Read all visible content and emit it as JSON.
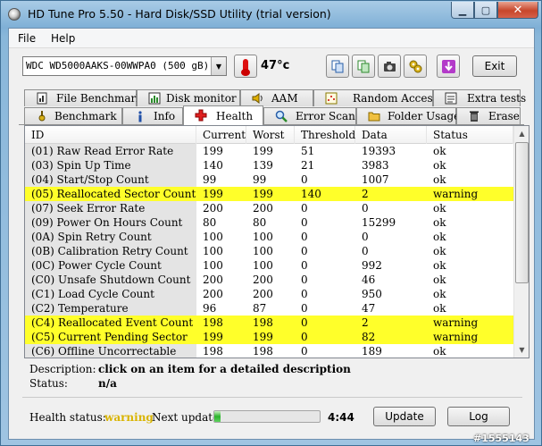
{
  "window": {
    "title": "HD Tune Pro 5.50 - Hard Disk/SSD Utility (trial version)"
  },
  "menu": {
    "file": "File",
    "help": "Help"
  },
  "toolbar": {
    "drive": "WDC WD5000AAKS-00WWPA0 (500 gB)",
    "temperature": "47°c",
    "exit": "Exit"
  },
  "tabs_top": [
    {
      "label": "File Benchmark",
      "icon": "file-benchmark-icon"
    },
    {
      "label": "Disk monitor",
      "icon": "disk-monitor-icon"
    },
    {
      "label": "AAM",
      "icon": "speaker-icon"
    },
    {
      "label": "Random Access",
      "icon": "random-access-icon"
    },
    {
      "label": "Extra tests",
      "icon": "extra-tests-icon"
    }
  ],
  "tabs_bottom": [
    {
      "label": "Benchmark",
      "icon": "benchmark-icon"
    },
    {
      "label": "Info",
      "icon": "info-icon"
    },
    {
      "label": "Health",
      "icon": "health-cross-icon"
    },
    {
      "label": "Error Scan",
      "icon": "magnifier-icon"
    },
    {
      "label": "Folder Usage",
      "icon": "folder-icon"
    },
    {
      "label": "Erase",
      "icon": "trash-icon"
    }
  ],
  "table": {
    "headers": [
      "ID",
      "Current",
      "Worst",
      "Threshold",
      "Data",
      "Status"
    ],
    "rows": [
      {
        "id": "(01) Raw Read Error Rate",
        "current": "199",
        "worst": "199",
        "threshold": "51",
        "data": "19393",
        "status": "ok",
        "warn": false
      },
      {
        "id": "(03) Spin Up Time",
        "current": "140",
        "worst": "139",
        "threshold": "21",
        "data": "3983",
        "status": "ok",
        "warn": false
      },
      {
        "id": "(04) Start/Stop Count",
        "current": "99",
        "worst": "99",
        "threshold": "0",
        "data": "1007",
        "status": "ok",
        "warn": false
      },
      {
        "id": "(05) Reallocated Sector Count",
        "current": "199",
        "worst": "199",
        "threshold": "140",
        "data": "2",
        "status": "warning",
        "warn": true
      },
      {
        "id": "(07) Seek Error Rate",
        "current": "200",
        "worst": "200",
        "threshold": "0",
        "data": "0",
        "status": "ok",
        "warn": false
      },
      {
        "id": "(09) Power On Hours Count",
        "current": "80",
        "worst": "80",
        "threshold": "0",
        "data": "15299",
        "status": "ok",
        "warn": false
      },
      {
        "id": "(0A) Spin Retry Count",
        "current": "100",
        "worst": "100",
        "threshold": "0",
        "data": "0",
        "status": "ok",
        "warn": false
      },
      {
        "id": "(0B) Calibration Retry Count",
        "current": "100",
        "worst": "100",
        "threshold": "0",
        "data": "0",
        "status": "ok",
        "warn": false
      },
      {
        "id": "(0C) Power Cycle Count",
        "current": "100",
        "worst": "100",
        "threshold": "0",
        "data": "992",
        "status": "ok",
        "warn": false
      },
      {
        "id": "(C0) Unsafe Shutdown Count",
        "current": "200",
        "worst": "200",
        "threshold": "0",
        "data": "46",
        "status": "ok",
        "warn": false
      },
      {
        "id": "(C1) Load Cycle Count",
        "current": "200",
        "worst": "200",
        "threshold": "0",
        "data": "950",
        "status": "ok",
        "warn": false
      },
      {
        "id": "(C2) Temperature",
        "current": "96",
        "worst": "87",
        "threshold": "0",
        "data": "47",
        "status": "ok",
        "warn": false
      },
      {
        "id": "(C4) Reallocated Event Count",
        "current": "198",
        "worst": "198",
        "threshold": "0",
        "data": "2",
        "status": "warning",
        "warn": true
      },
      {
        "id": "(C5) Current Pending Sector",
        "current": "199",
        "worst": "199",
        "threshold": "0",
        "data": "82",
        "status": "warning",
        "warn": true
      },
      {
        "id": "(C6) Offline Uncorrectable",
        "current": "198",
        "worst": "198",
        "threshold": "0",
        "data": "189",
        "status": "ok",
        "warn": false
      }
    ]
  },
  "description": {
    "label": "Description:",
    "value": "click on an item for a detailed description",
    "status_label": "Status:",
    "status_value": "n/a"
  },
  "footer": {
    "health_label": "Health status:",
    "health_value": "warning",
    "next_label": "Next update:",
    "progress_fraction": 0.06,
    "time": "4:44",
    "update": "Update",
    "log": "Log"
  },
  "watermark": "#1555143",
  "colors": {
    "warning_row": "#ffff2a",
    "health_warning_text": "#d9b400",
    "title_bar": "#7fb0d6"
  }
}
